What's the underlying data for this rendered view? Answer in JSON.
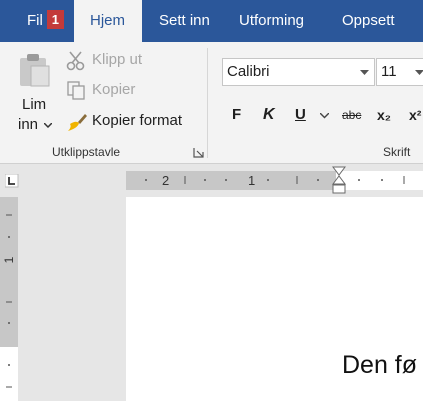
{
  "tabs": [
    {
      "label": "Fil",
      "badge": "1"
    },
    {
      "label": "Hjem"
    },
    {
      "label": "Sett inn"
    },
    {
      "label": "Utforming"
    },
    {
      "label": "Oppsett"
    }
  ],
  "clipboard": {
    "paste_label_line1": "Lim",
    "paste_label_line2": "inn",
    "cut_label": "Klipp ut",
    "copy_label": "Kopier",
    "format_painter_label": "Kopier format",
    "group_name": "Utklippstavle"
  },
  "font": {
    "font_name": "Calibri",
    "font_size": "11",
    "bold_label": "F",
    "italic_label": "K",
    "underline_label": "U",
    "strikethrough_label": "abc",
    "subscript_label": "x₂",
    "superscript_label": "x²",
    "group_name": "Skrift"
  },
  "ruler": {
    "h_labels": [
      "2",
      "1"
    ],
    "v_labels": [
      "1"
    ]
  },
  "document": {
    "text": "Den fø"
  },
  "colors": {
    "tabbar": "#2b579a",
    "ribbon": "#f3f3f3",
    "badge": "#c33a3a",
    "ruler_gray": "#c7c7c7"
  }
}
